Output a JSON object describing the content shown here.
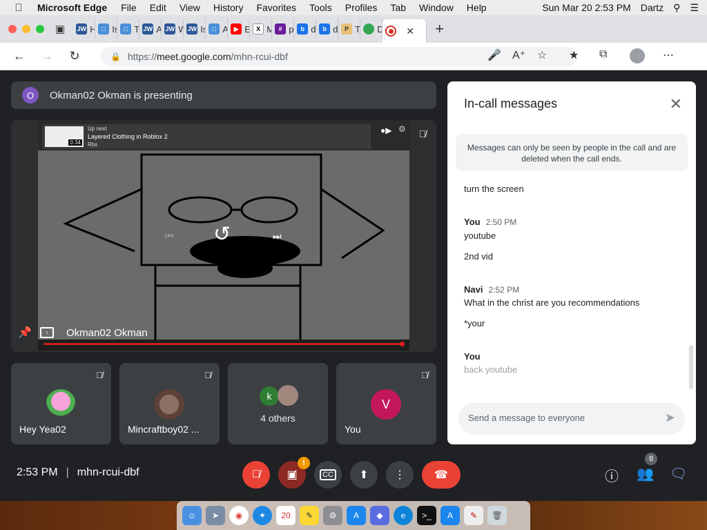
{
  "menubar": {
    "app_name": "Microsoft Edge",
    "items": [
      "File",
      "Edit",
      "View",
      "History",
      "Favorites",
      "Tools",
      "Profiles",
      "Tab",
      "Window",
      "Help"
    ],
    "datetime": "Sun Mar 20  2:53 PM",
    "user": "Dartz"
  },
  "tabs": [
    {
      "label": "Hor",
      "icon": "jw-icon"
    },
    {
      "label": "Is t",
      "icon": "doc-icon"
    },
    {
      "label": "The",
      "icon": "doc-icon"
    },
    {
      "label": "Am",
      "icon": "jw-icon"
    },
    {
      "label": "Wh",
      "icon": "jw-icon"
    },
    {
      "label": "Is H",
      "icon": "jw-icon"
    },
    {
      "label": "An",
      "icon": "doc-icon"
    },
    {
      "label": "Edi",
      "icon": "youtube-icon"
    },
    {
      "label": "Ma",
      "icon": "ma-icon"
    },
    {
      "label": "pw",
      "icon": "hash-icon"
    },
    {
      "label": "dov",
      "icon": "bing-icon"
    },
    {
      "label": "dov",
      "icon": "bing-icon"
    },
    {
      "label": "Top",
      "icon": "p-icon"
    },
    {
      "label": "Dov",
      "icon": "green-dot-icon"
    },
    {
      "label": "",
      "icon": "record-icon"
    }
  ],
  "address": {
    "scheme": "https://",
    "host": "meet.google.com",
    "path": "/mhn-rcui-dbf"
  },
  "presenting_banner": {
    "initial": "O",
    "text": "Okman02 Okman is presenting"
  },
  "main_video": {
    "upnext_label": "Up next",
    "upnext_title": "Layered Clothing in Roblox 2",
    "upnext_channel": "Rbx",
    "thumb_duration": "0:34",
    "presenter_name": "Okman02 Okman"
  },
  "tiles": [
    {
      "name": "Hey Yea02"
    },
    {
      "name": "Mincraftboy02 ..."
    },
    {
      "name": "4 others",
      "initial": "k"
    },
    {
      "name": "You",
      "initial": "V"
    }
  ],
  "chat": {
    "title": "In-call messages",
    "notice": "Messages can only be seen by people in the call and are deleted when the call ends.",
    "messages": [
      {
        "sender": "",
        "time": "",
        "text": "turn the screen"
      },
      {
        "sender": "You",
        "time": "2:50 PM",
        "text": "youtube"
      },
      {
        "sender": "",
        "time": "",
        "text": "2nd vid"
      },
      {
        "sender": "Navi",
        "time": "2:52 PM",
        "text": "What in the christ are you recommendations"
      },
      {
        "sender": "",
        "time": "",
        "text": "*your"
      },
      {
        "sender": "You",
        "time": "",
        "text": "back youtube",
        "pending": true
      }
    ],
    "input_placeholder": "Send a message to everyone"
  },
  "controls": {
    "time": "2:53 PM",
    "meeting_code": "mhn-rcui-dbf",
    "participants_count": "8"
  },
  "colors": {
    "mic_off_red": "#ea4335",
    "presenter_purple": "#7e57c2",
    "you_avatar": "#c2185b",
    "chat_active_blue": "#8ab4f8",
    "progress_red": "#cc1d1d"
  }
}
